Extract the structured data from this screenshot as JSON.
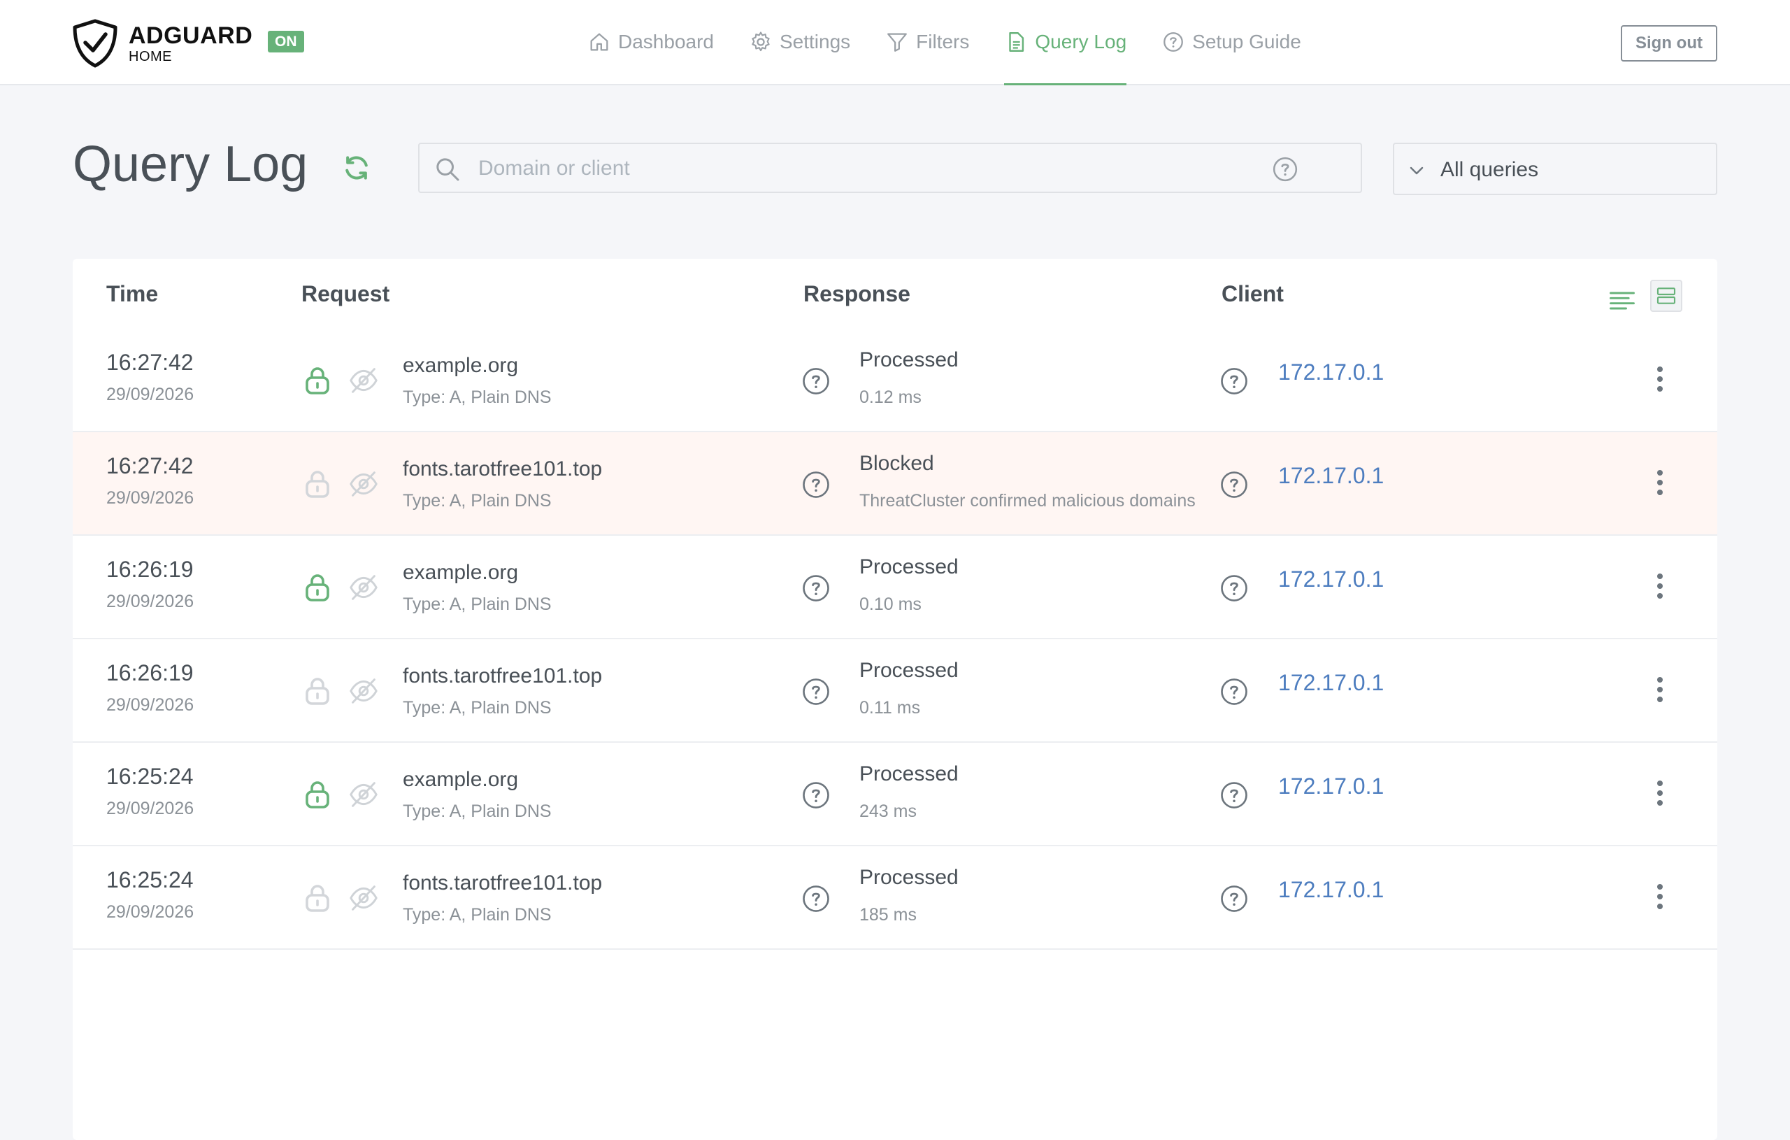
{
  "header": {
    "brand_main": "ADGUARD",
    "brand_sub": "HOME",
    "status_badge": "ON",
    "nav": [
      {
        "label": "Dashboard",
        "icon": "home-icon"
      },
      {
        "label": "Settings",
        "icon": "gear-icon"
      },
      {
        "label": "Filters",
        "icon": "filter-icon"
      },
      {
        "label": "Query Log",
        "icon": "document-icon",
        "active": true
      },
      {
        "label": "Setup Guide",
        "icon": "help-circle-icon"
      }
    ],
    "sign_out": "Sign out"
  },
  "page": {
    "title": "Query Log",
    "search_placeholder": "Domain or client",
    "filter_selected": "All queries"
  },
  "table": {
    "headers": {
      "time": "Time",
      "request": "Request",
      "response": "Response",
      "client": "Client"
    },
    "rows": [
      {
        "time": "16:27:42",
        "date": "29/09/2026",
        "domain": "example.org",
        "type": "Type: A, Plain DNS",
        "status": "Processed",
        "detail": "0.12 ms",
        "client": "172.17.0.1",
        "lock": "green",
        "blocked": false
      },
      {
        "time": "16:27:42",
        "date": "29/09/2026",
        "domain": "fonts.tarotfree101.top",
        "type": "Type: A, Plain DNS",
        "status": "Blocked",
        "detail": "ThreatCluster confirmed malicious domains",
        "client": "172.17.0.1",
        "lock": "grey",
        "blocked": true
      },
      {
        "time": "16:26:19",
        "date": "29/09/2026",
        "domain": "example.org",
        "type": "Type: A, Plain DNS",
        "status": "Processed",
        "detail": "0.10 ms",
        "client": "172.17.0.1",
        "lock": "green",
        "blocked": false
      },
      {
        "time": "16:26:19",
        "date": "29/09/2026",
        "domain": "fonts.tarotfree101.top",
        "type": "Type: A, Plain DNS",
        "status": "Processed",
        "detail": "0.11 ms",
        "client": "172.17.0.1",
        "lock": "grey",
        "blocked": false
      },
      {
        "time": "16:25:24",
        "date": "29/09/2026",
        "domain": "example.org",
        "type": "Type: A, Plain DNS",
        "status": "Processed",
        "detail": "243 ms",
        "client": "172.17.0.1",
        "lock": "green",
        "blocked": false
      },
      {
        "time": "16:25:24",
        "date": "29/09/2026",
        "domain": "fonts.tarotfree101.top",
        "type": "Type: A, Plain DNS",
        "status": "Processed",
        "detail": "185 ms",
        "client": "172.17.0.1",
        "lock": "grey",
        "blocked": false
      }
    ]
  },
  "colors": {
    "accent": "#67b279",
    "link": "#4d7dbf",
    "blocked_row": "#fff6f3"
  }
}
